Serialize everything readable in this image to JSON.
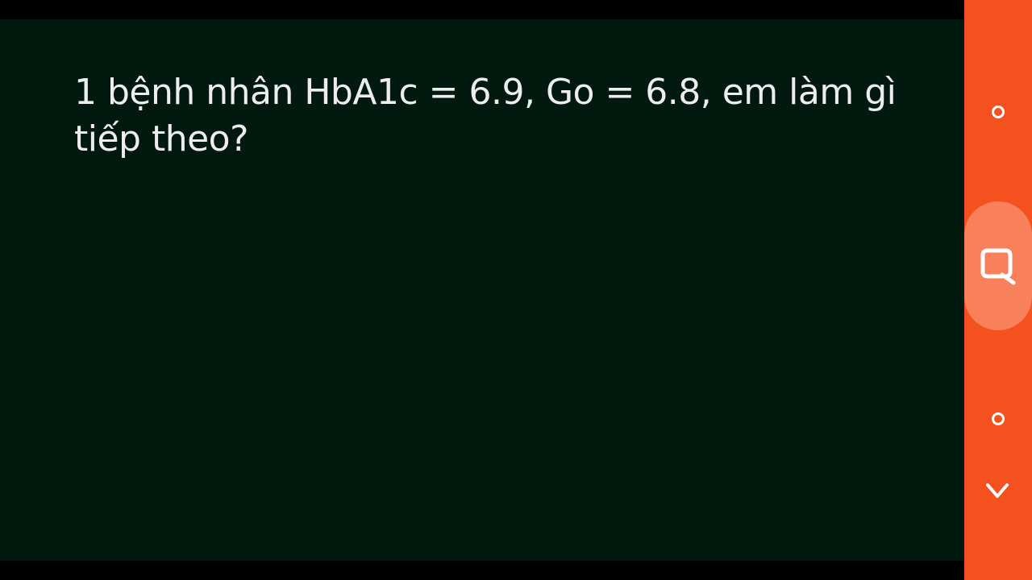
{
  "slide": {
    "text_line_1": "1 bệnh nhân HbA1c = 6.9, Go = 6.8, em làm gì",
    "text_line_2": "tiếp theo?"
  },
  "colors": {
    "slide_background": "#02190f",
    "panel_accent": "#f4511e",
    "panel_button": "#f8805a",
    "text": "#ededed"
  },
  "side_panel": {
    "icons": [
      "circle-icon",
      "search-chat-icon",
      "circle-icon",
      "chevron-down-icon"
    ]
  }
}
